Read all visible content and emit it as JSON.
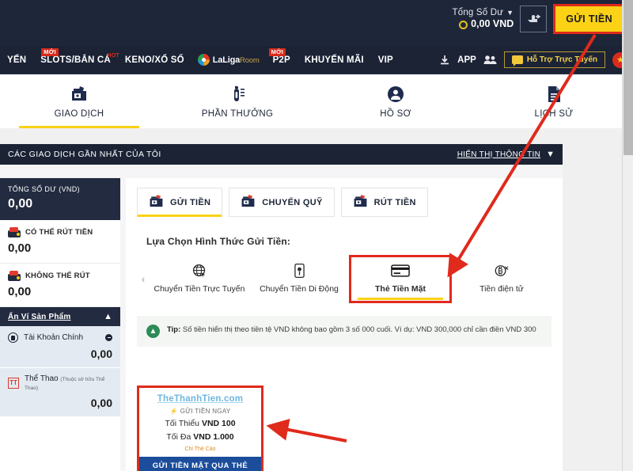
{
  "topbar": {
    "balance_label": "Tổng Số Dư",
    "chevron": "⌄",
    "balance_value": "0,00 VND",
    "refresh_icon": "☞",
    "deposit_button": "GỬI TIỀN"
  },
  "nav": {
    "items": [
      {
        "label": "YẾN",
        "badge": ""
      },
      {
        "label": "SLOTS/BẮN CÁ",
        "badge": "MỚI",
        "hot": "HOT"
      },
      {
        "label": "KENO/XỔ SỐ",
        "badge": ""
      },
      {
        "label": "P2P",
        "badge": "MỚI"
      },
      {
        "label": "KHUYẾN MÃI",
        "badge": ""
      },
      {
        "label": "VIP",
        "badge": ""
      }
    ],
    "laliga_main": "LaLiga",
    "laliga_sub": "Room",
    "download_icon": "⬇",
    "app_label": "APP",
    "friends_icon": "὆5",
    "support_label": "Hỗ Trợ Trực Tuyến",
    "star_icon": "★"
  },
  "tabs": [
    {
      "label": "GIAO DỊCH",
      "icon": "wallet-icon",
      "active": true
    },
    {
      "label": "PHẦN THƯỞNG",
      "icon": "gift-icon",
      "active": false
    },
    {
      "label": "HỒ SƠ",
      "icon": "profile-icon",
      "active": false
    },
    {
      "label": "LỊCH SỬ",
      "icon": "history-icon",
      "active": false
    }
  ],
  "section_header": {
    "title": "CÁC GIAO DỊCH GẦN NHẤT CỦA TÔI",
    "toggle_label": "HIỂN THỊ THÔNG TIN",
    "toggle_chevron": "⌵"
  },
  "sidebar": {
    "total_label": "TỔNG SỐ DƯ",
    "total_currency": "(VND)",
    "total_value": "0,00",
    "rows": [
      {
        "label": "CÓ THỂ RÚT TIỀN",
        "value": "0,00"
      },
      {
        "label": "KHÔNG THỂ RÚT",
        "value": "0,00"
      }
    ],
    "group_title": "Ẩn Ví Sản Phẩm",
    "group_chevron": "⌃",
    "products": [
      {
        "name": "Tài Khoản Chính",
        "sub": "",
        "value": "0,00"
      },
      {
        "name": "Thể Thao",
        "sub": "(Thuộc sở hữu Thể Thao)",
        "value": "0,00"
      }
    ]
  },
  "main": {
    "method_tabs": [
      {
        "label": "GỬI TIỀN",
        "active": true
      },
      {
        "label": "CHUYỂN QUỸ",
        "active": false
      },
      {
        "label": "RÚT TIỀN",
        "active": false
      }
    ],
    "choose_title": "Lựa Chọn Hình Thức Gửi Tiền:",
    "carousel_prev": "‹",
    "carousel": [
      {
        "label": "Chuyển Tiền Trực Tuyến",
        "icon": "globe-icon",
        "selected": false
      },
      {
        "label": "Chuyển Tiền Di Động",
        "icon": "mobile-icon",
        "selected": false
      },
      {
        "label": "Thẻ Tiền Mặt",
        "icon": "card-icon",
        "selected": true
      },
      {
        "label": "Tiền điện tử",
        "icon": "crypto-icon",
        "selected": false
      }
    ],
    "tip_prefix": "Tip:",
    "tip_text": " Số tiền hiển thị theo tiền tệ VND không bao gồm 3 số 000 cuối. Ví dụ: VND 300,000 chỉ cần điền VND 300",
    "offer": {
      "logo": "TheThanhTien.com",
      "now_icon": "⚡",
      "now_label": "GỬI TIỀN NGAY",
      "min_label": "Tối Thiểu",
      "min_value": "VND 100",
      "max_label": "Tối Đa",
      "max_value": "VND 1.000",
      "note": "Chỉ Thẻ Cào",
      "button": "GỬI TIỀN MẶT QUA THẺ"
    }
  },
  "colors": {
    "dark_navy": "#1b2335",
    "yellow": "#fbd216",
    "red_accent": "#e02a1c",
    "blue_button": "#1b4d9b"
  }
}
